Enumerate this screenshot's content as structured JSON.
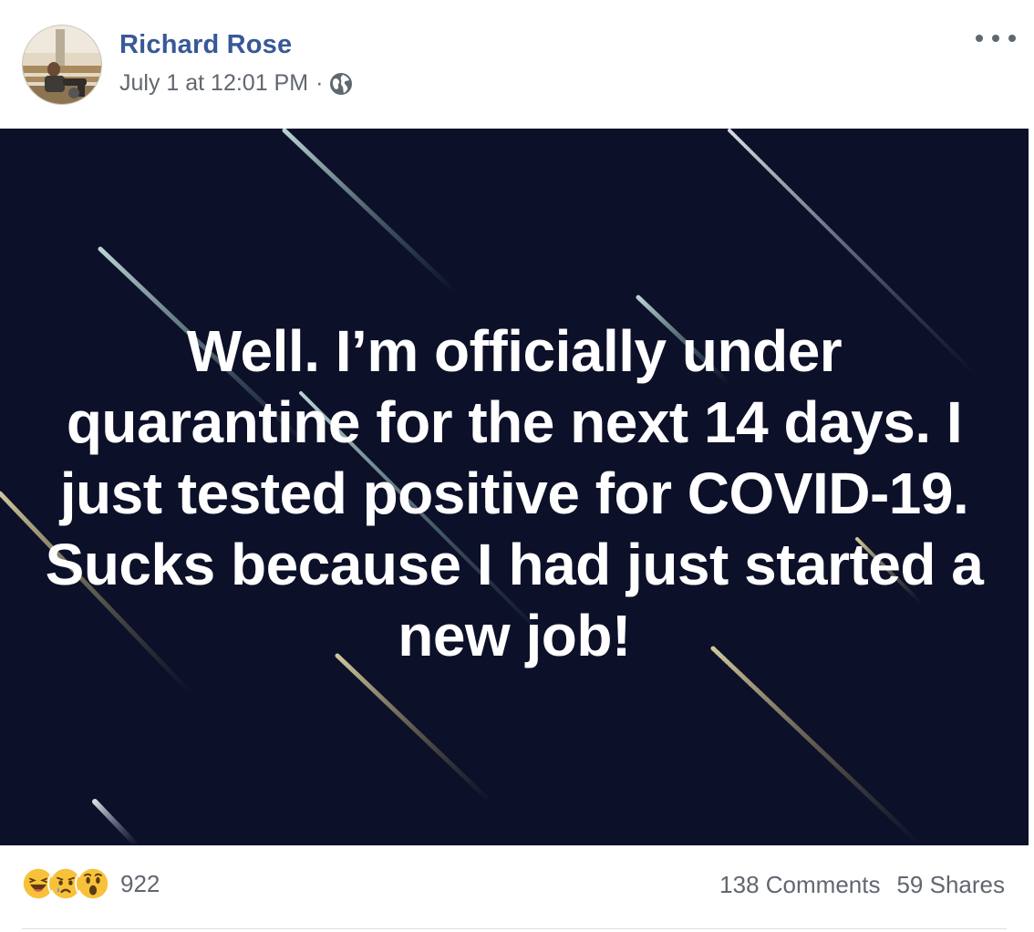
{
  "post": {
    "author": "Richard Rose",
    "timestamp": "July 1 at 12:01 PM",
    "separator": "·",
    "privacy_icon": "globe-icon",
    "more_icon": "more-options-icon",
    "text": "Well. I’m officially under quarantine for the next 14 days. I just tested positive for COVID-19. Sucks because I had just started a new job!",
    "background_color": "#0c1029"
  },
  "reactions": {
    "icons": [
      "haha-reaction-icon",
      "sad-reaction-icon",
      "wow-reaction-icon"
    ],
    "count": "922"
  },
  "stats": {
    "comments": "138 Comments",
    "shares": "59 Shares"
  },
  "colors": {
    "author_link": "#385898",
    "secondary_text": "#606770"
  }
}
